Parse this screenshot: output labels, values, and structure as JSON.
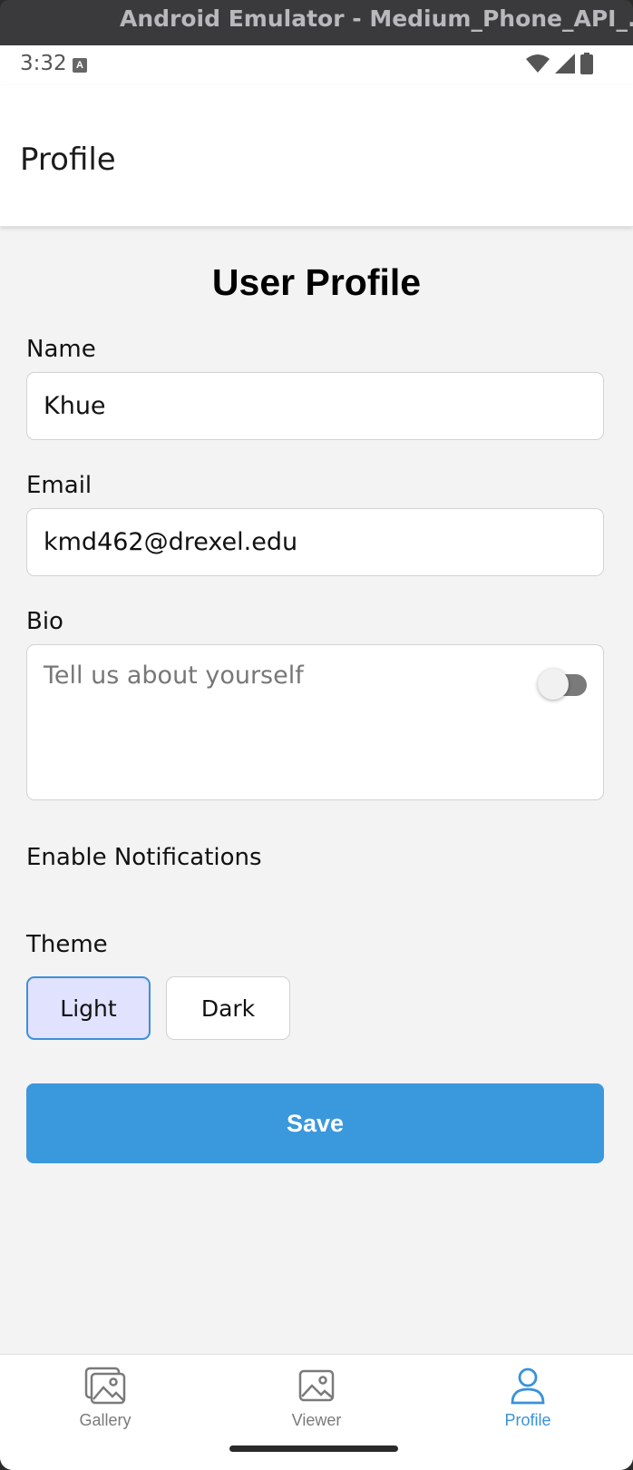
{
  "window": {
    "title": "Android Emulator - Medium_Phone_API_..."
  },
  "status_bar": {
    "time": "3:32",
    "notification_icon": "A"
  },
  "header": {
    "title": "Profile"
  },
  "form": {
    "heading": "User Profile",
    "name_label": "Name",
    "name_value": "Khue",
    "email_label": "Email",
    "email_value": "kmd462@drexel.edu",
    "bio_label": "Bio",
    "bio_value": "",
    "bio_placeholder": "Tell us about yourself",
    "notifications_label": "Enable Notifications",
    "notifications_enabled": false,
    "theme_label": "Theme",
    "theme_options": [
      "Light",
      "Dark"
    ],
    "theme_selected": "Light",
    "save_label": "Save"
  },
  "tabs": [
    {
      "label": "Gallery",
      "icon": "gallery-icon",
      "active": false
    },
    {
      "label": "Viewer",
      "icon": "image-icon",
      "active": false
    },
    {
      "label": "Profile",
      "icon": "person-icon",
      "active": true
    }
  ],
  "colors": {
    "accent": "#3a98dc",
    "active_tab": "#3a92d8",
    "selected_theme_bg": "#e1e2fe",
    "background": "#f3f3f3"
  }
}
